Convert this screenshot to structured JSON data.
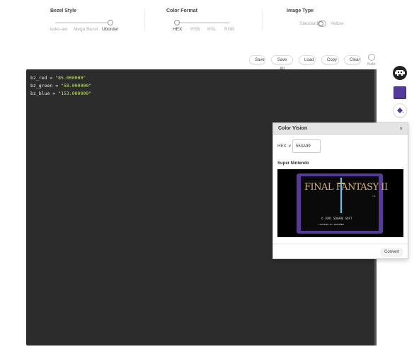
{
  "bezel_style": {
    "title": "Bezel Style",
    "options": [
      "koko-aio",
      "Mega Bezel",
      "Uborder"
    ],
    "selected_index": 2
  },
  "color_format": {
    "title": "Color Format",
    "options": [
      "HEX",
      "HSB",
      "HSL",
      "RGB"
    ],
    "selected_index": 0
  },
  "image_type": {
    "title": "Image Type",
    "left_label": "Standard",
    "right_label": "Yellow"
  },
  "actions": {
    "save": "Save",
    "save_all": "Save All",
    "load": "Load",
    "copy": "Copy",
    "clear": "Clear",
    "build": "Build"
  },
  "editor": {
    "lines": [
      {
        "name": "bz_red",
        "value": "\"85.000000\""
      },
      {
        "name": "bz_green",
        "value": "\"58.000000\""
      },
      {
        "name": "bz_blue",
        "value": "\"153.000000\""
      }
    ]
  },
  "swatch_color": "#553A99",
  "color_vision": {
    "title": "Color Vision",
    "close": "×",
    "hex_label": "HEX: #",
    "hex_value": "553A99",
    "system_label": "Super Nintendo",
    "game_title": "FINAL FANTASY II",
    "copyright": "© 1991 SQUARE SOFT",
    "licensed": "LICENSED BY NINTENDO",
    "tm": "TM",
    "convert": "Convert"
  }
}
